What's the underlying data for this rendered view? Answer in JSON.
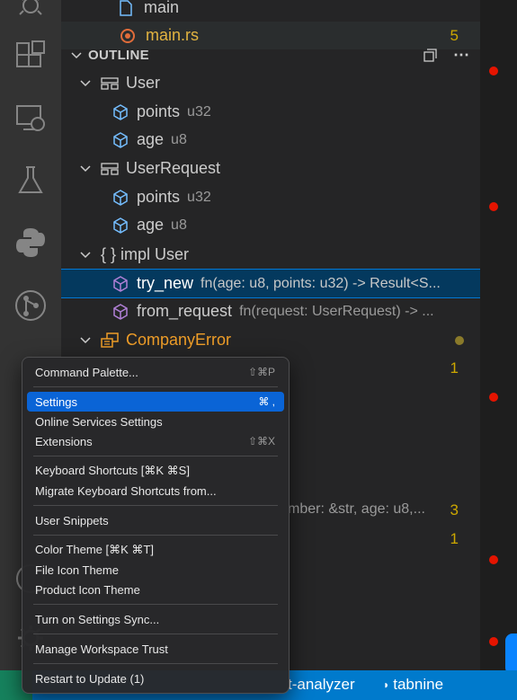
{
  "explorer": {
    "file_main": "main",
    "file_main_rs": "main.rs",
    "file_main_rs_badge": "5"
  },
  "outline": {
    "title": "OUTLINE",
    "items": [
      {
        "name": "User",
        "detail": ""
      },
      {
        "name": "points",
        "detail": "u32"
      },
      {
        "name": "age",
        "detail": "u8"
      },
      {
        "name": "UserRequest",
        "detail": ""
      },
      {
        "name": "points",
        "detail": "u32"
      },
      {
        "name": "age",
        "detail": "u8"
      },
      {
        "name": "{ } impl User",
        "detail": ""
      },
      {
        "name": "try_new",
        "detail": "fn(age: u8, points: u32) -> Result<S..."
      },
      {
        "name": "from_request",
        "detail": "fn(request: UserRequest) -> ..."
      },
      {
        "name": "CompanyError",
        "detail": ""
      }
    ],
    "partial_detail": "mber: &str, age: u8,...",
    "badges": [
      "1",
      "3",
      "1"
    ]
  },
  "menu": {
    "items": [
      {
        "label": "Command Palette...",
        "shortcut": "⇧⌘P"
      },
      {
        "label": "Settings",
        "shortcut": "⌘ ,"
      },
      {
        "label": "Online Services Settings",
        "shortcut": ""
      },
      {
        "label": "Extensions",
        "shortcut": "⇧⌘X"
      },
      {
        "label": "Keyboard Shortcuts [⌘K ⌘S]",
        "shortcut": ""
      },
      {
        "label": "Migrate Keyboard Shortcuts from...",
        "shortcut": ""
      },
      {
        "label": "User Snippets",
        "shortcut": ""
      },
      {
        "label": "Color Theme [⌘K ⌘T]",
        "shortcut": ""
      },
      {
        "label": "File Icon Theme",
        "shortcut": ""
      },
      {
        "label": "Product Icon Theme",
        "shortcut": ""
      },
      {
        "label": "Turn on Settings Sync...",
        "shortcut": ""
      },
      {
        "label": "Manage Workspace Trust",
        "shortcut": ""
      },
      {
        "label": "Restart to Update (1)",
        "shortcut": ""
      }
    ]
  },
  "statusbar": {
    "analyzer": "t-analyzer",
    "tabnine": "tabnine"
  },
  "colors": {
    "accent": "#007acc",
    "selection": "#04395e",
    "menu_highlight": "#0a64d6",
    "struct_icon": "#75beff",
    "method_icon": "#b180d7",
    "enum_color": "#ee9d28",
    "error_dot": "#e51400"
  }
}
